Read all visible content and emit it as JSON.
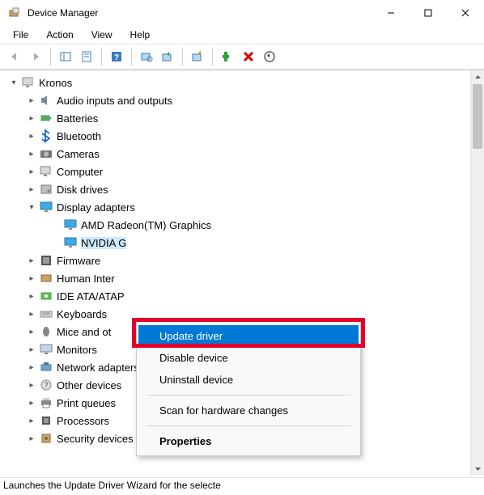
{
  "window": {
    "title": "Device Manager"
  },
  "menus": {
    "file": "File",
    "action": "Action",
    "view": "View",
    "help": "Help"
  },
  "tree": {
    "root": "Kronos",
    "categories": [
      {
        "label": "Audio inputs and outputs",
        "icon": "speaker"
      },
      {
        "label": "Batteries",
        "icon": "battery"
      },
      {
        "label": "Bluetooth",
        "icon": "bluetooth"
      },
      {
        "label": "Cameras",
        "icon": "camera"
      },
      {
        "label": "Computer",
        "icon": "computer"
      },
      {
        "label": "Disk drives",
        "icon": "disk"
      },
      {
        "label": "Display adapters",
        "icon": "display",
        "expanded": true,
        "children": [
          {
            "label": "AMD Radeon(TM) Graphics",
            "icon": "display"
          },
          {
            "label": "NVIDIA G",
            "icon": "display",
            "selected": true
          }
        ]
      },
      {
        "label": "Firmware",
        "icon": "firmware"
      },
      {
        "label": "Human Inter",
        "icon": "hid"
      },
      {
        "label": "IDE ATA/ATAP",
        "icon": "ide"
      },
      {
        "label": "Keyboards",
        "icon": "keyboard"
      },
      {
        "label": "Mice and ot",
        "icon": "mouse"
      },
      {
        "label": "Monitors",
        "icon": "monitor"
      },
      {
        "label": "Network adapters",
        "icon": "network"
      },
      {
        "label": "Other devices",
        "icon": "other"
      },
      {
        "label": "Print queues",
        "icon": "printer"
      },
      {
        "label": "Processors",
        "icon": "cpu"
      },
      {
        "label": "Security devices",
        "icon": "security"
      }
    ]
  },
  "context_menu": {
    "items": [
      {
        "label": "Update driver",
        "highlight": true
      },
      {
        "label": "Disable device"
      },
      {
        "label": "Uninstall device"
      },
      {
        "sep": true
      },
      {
        "label": "Scan for hardware changes"
      },
      {
        "sep": true
      },
      {
        "label": "Properties",
        "bold": true
      }
    ]
  },
  "statusbar": {
    "text": "Launches the Update Driver Wizard for the selecte"
  }
}
